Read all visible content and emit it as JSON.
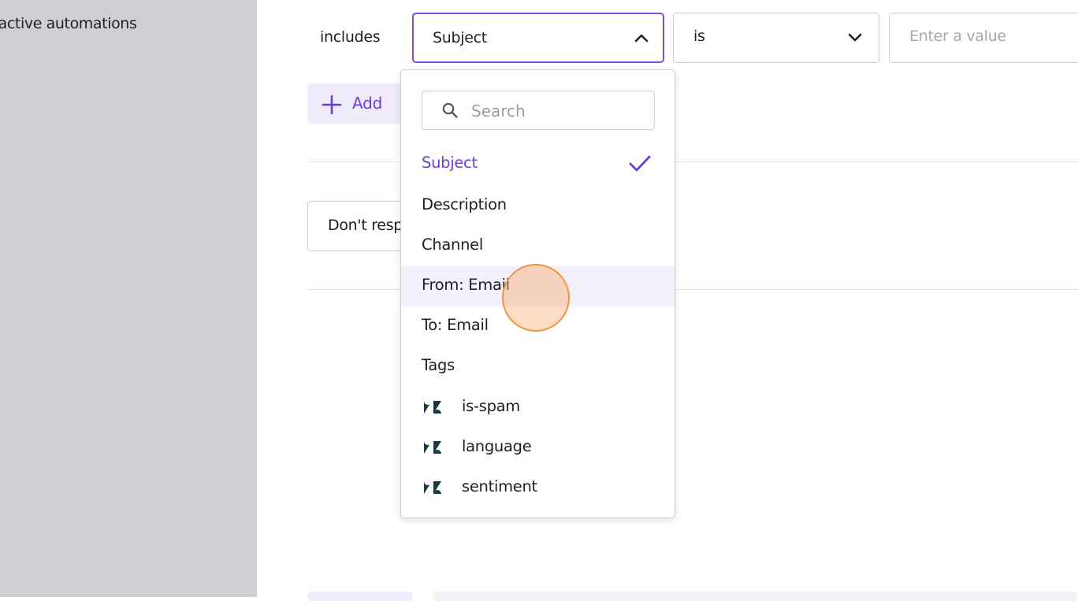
{
  "sidebar": {
    "item_label": "nactive automations"
  },
  "rule": {
    "label": "includes",
    "field_select": {
      "value": "Subject",
      "expanded": true
    },
    "operator_select": {
      "value": "is"
    },
    "value_input": {
      "placeholder": "Enter a value"
    }
  },
  "add_button": {
    "label": "Add"
  },
  "secondary_button": {
    "label": "Don't respond"
  },
  "dropdown": {
    "search_placeholder": "Search",
    "options": [
      {
        "label": "Subject",
        "selected": true
      },
      {
        "label": "Description"
      },
      {
        "label": "Channel"
      },
      {
        "label": "From: Email",
        "hovered": true
      },
      {
        "label": "To: Email"
      },
      {
        "label": "Tags"
      },
      {
        "label": "is-spam",
        "icon": "zendesk-logo-icon"
      },
      {
        "label": "language",
        "icon": "zendesk-logo-icon"
      },
      {
        "label": "sentiment",
        "icon": "zendesk-logo-icon"
      }
    ]
  },
  "colors": {
    "accent": "#7a4fdb",
    "accent_text": "#6b3fd6",
    "hover_bg": "#f3effb",
    "sidebar_bg": "#cfd0d5",
    "cursor": "#ef9440"
  }
}
